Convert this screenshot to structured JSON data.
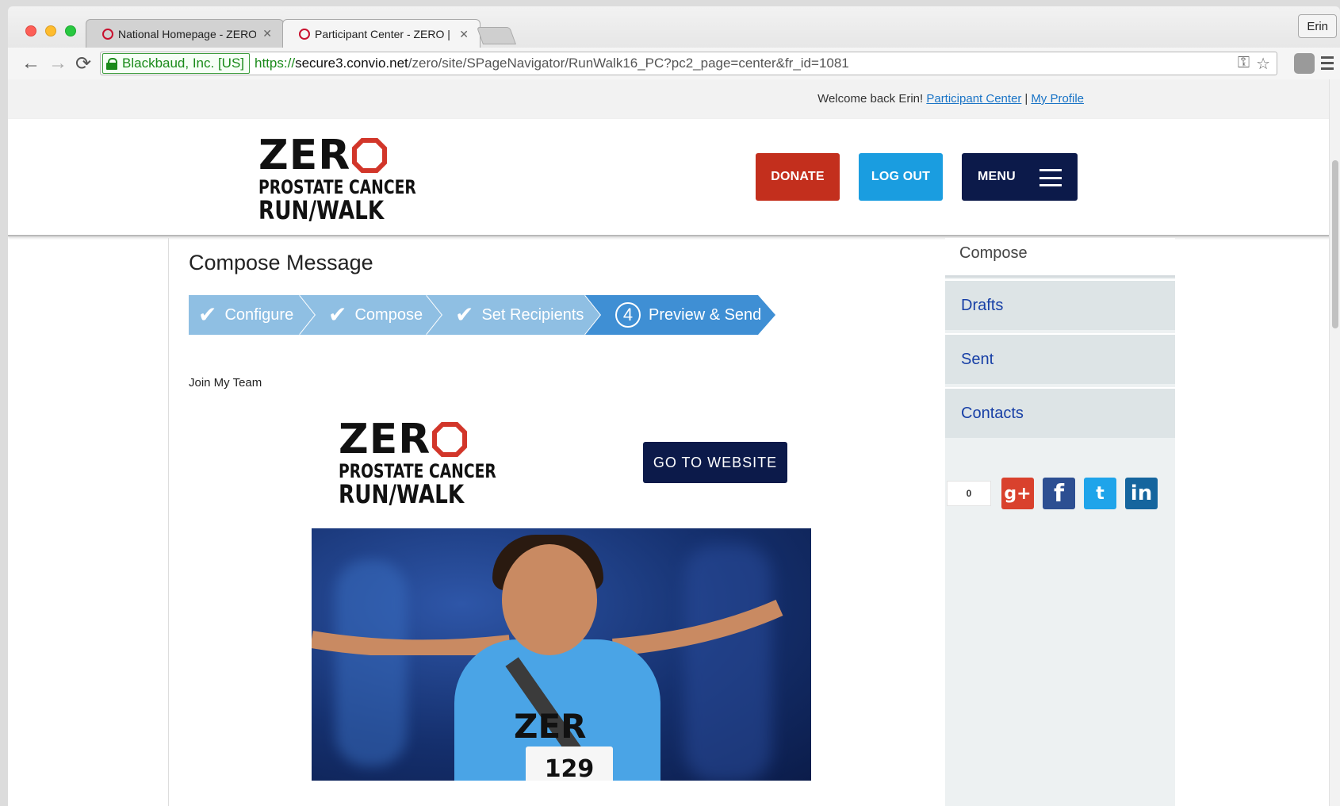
{
  "browser": {
    "tabs": [
      {
        "title": "National Homepage - ZERO",
        "active": false
      },
      {
        "title": "Participant Center - ZERO |",
        "active": true
      }
    ],
    "profile": "Erin",
    "ev_badge": "Blackbaud, Inc. [US]",
    "url": {
      "scheme": "https://",
      "host": "secure3.convio.net",
      "path": "/zero/site/SPageNavigator/RunWalk16_PC?pc2_page=center&fr_id=1081"
    },
    "icons": {
      "back": "back-arrow-icon",
      "forward": "forward-arrow-icon",
      "reload": "reload-icon",
      "key": "key-icon",
      "star": "bookmark-star-icon"
    }
  },
  "welcome": {
    "text": "Welcome back Erin!",
    "participant_center": "Participant Center",
    "separator": "|",
    "my_profile": "My Profile"
  },
  "logo": {
    "zero": "ZER",
    "line2": "PROSTATE CANCER",
    "line3": "RUN/WALK"
  },
  "header": {
    "donate": "DONATE",
    "logout": "LOG OUT",
    "menu": "MENU"
  },
  "compose": {
    "title": "Compose Message",
    "steps": [
      {
        "label": "Configure",
        "done": true
      },
      {
        "label": "Compose",
        "done": true
      },
      {
        "label": "Set Recipients",
        "done": true
      },
      {
        "label": "Preview & Send",
        "number": "4",
        "current": true
      }
    ],
    "check_glyph": "✔",
    "subject": "Join My Team",
    "goto_button": "GO TO WEBSITE",
    "photo": {
      "shirt": "ZER",
      "bib_number": "129"
    }
  },
  "sidebar": {
    "heading": "Compose",
    "items": [
      "Drafts",
      "Sent",
      "Contacts"
    ],
    "share_count": "0",
    "social": {
      "google": "g+",
      "facebook": "f",
      "twitter": "t",
      "linkedin": "in"
    }
  },
  "colors": {
    "donate": "#c32f1d",
    "logout": "#1a9de0",
    "navy": "#0c1a4a",
    "step_done": "#8fbfe3",
    "step_current": "#3f8fd4",
    "link": "#1a74c6",
    "sidebar_link": "#173fa6"
  }
}
